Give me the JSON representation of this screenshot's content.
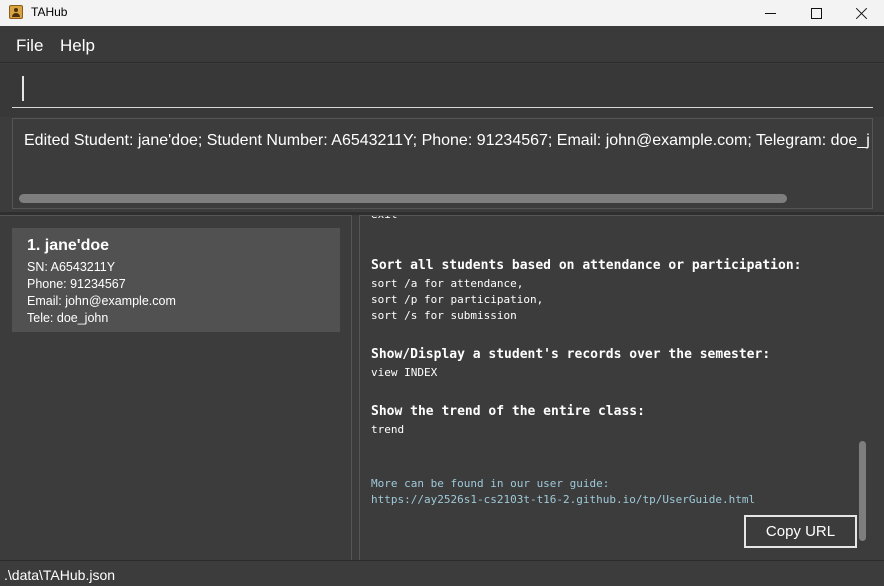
{
  "window": {
    "title": "TAHub",
    "icon": "app-icon"
  },
  "menu": {
    "items": [
      {
        "label": "File"
      },
      {
        "label": "Help"
      }
    ]
  },
  "command": {
    "value": "",
    "placeholder": ""
  },
  "result": {
    "text": "Edited Student: jane'doe; Student Number: A6543211Y; Phone: 91234567; Email: john@example.com; Telegram: doe_john"
  },
  "students": [
    {
      "index_name": "1. jane'doe",
      "sn": "SN: A6543211Y",
      "phone": "Phone: 91234567",
      "email": "Email: john@example.com",
      "tele": "Tele: doe_john"
    }
  ],
  "help": {
    "partial_top": "exit",
    "sort_heading": "Sort all students based on attendance or participation:",
    "sort_lines": [
      "sort /a for attendance,",
      "sort /p for participation,",
      "sort /s for submission"
    ],
    "view_heading": "Show/Display a student's records over the semester:",
    "view_line": "view INDEX",
    "trend_heading": "Show the trend of the entire class:",
    "trend_line": "trend",
    "more_text": "More can be found in our user guide:",
    "url": "https://ay2526s1-cs2103t-t16-2.github.io/tp/UserGuide.html",
    "copy_button_label": "Copy URL"
  },
  "status": {
    "path": ".\\data\\TAHub.json"
  }
}
